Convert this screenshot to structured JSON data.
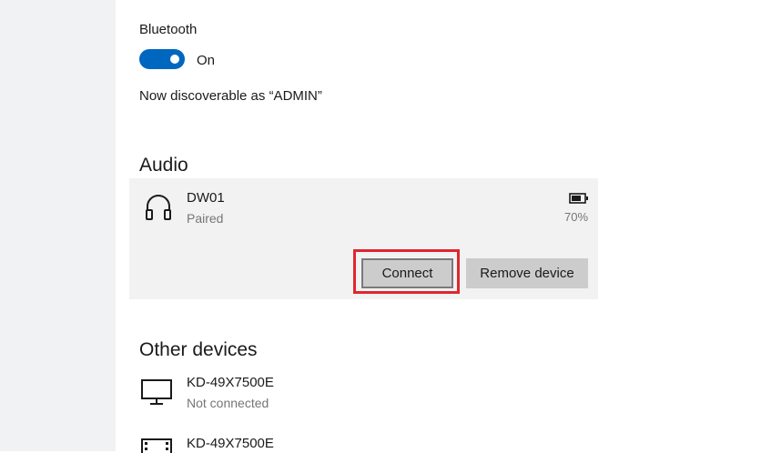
{
  "bluetooth": {
    "label": "Bluetooth",
    "toggle_state": "On",
    "discoverable_text": "Now discoverable as “ADMIN”"
  },
  "audio": {
    "title": "Audio",
    "device": {
      "name": "DW01",
      "status": "Paired",
      "battery": "70%",
      "icon": "headphones-icon"
    },
    "buttons": {
      "connect": "Connect",
      "remove": "Remove device"
    },
    "highlight_color": "#e0262e"
  },
  "other_devices": {
    "title": "Other devices",
    "items": [
      {
        "name": "KD-49X7500E",
        "status": "Not connected",
        "icon": "monitor-icon"
      },
      {
        "name": "KD-49X7500E",
        "status": "",
        "icon": "media-device-icon"
      }
    ]
  },
  "colors": {
    "accent": "#0067c0",
    "card_bg": "#f2f2f2",
    "sidebar_bg": "#f0f2f4"
  }
}
